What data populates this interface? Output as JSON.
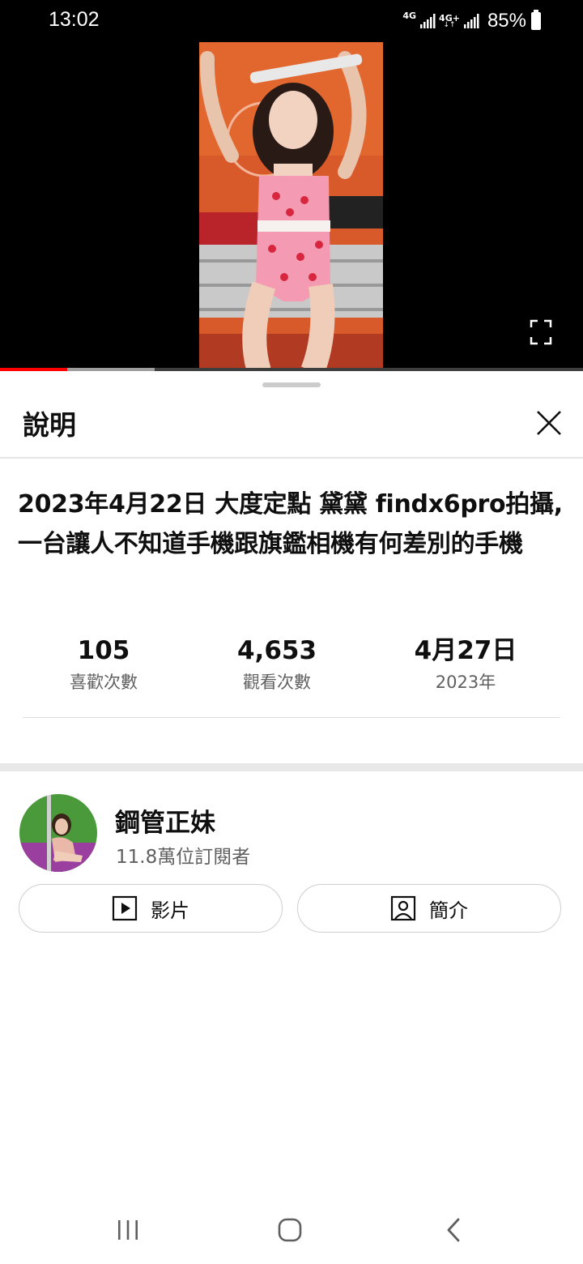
{
  "status_bar": {
    "time": "13:02",
    "network_1": "4G",
    "network_2": "4G+",
    "network_2_arrows": "↓↑",
    "battery": "85%"
  },
  "player": {
    "progress_fraction": 0.115,
    "buffer_fraction": 0.265,
    "accent_color": "#ff0000"
  },
  "description_panel": {
    "title": "說明",
    "close_icon": "close-icon"
  },
  "video": {
    "title": "2023年4月22日 大度定點 黛黛 findx6pro拍攝,一台讓人不知道手機跟旗鑑相機有何差別的手機"
  },
  "stats": [
    {
      "value": "105",
      "label": "喜歡次數"
    },
    {
      "value": "4,653",
      "label": "觀看次數"
    },
    {
      "value": "4月27日",
      "label": "2023年"
    }
  ],
  "channel": {
    "name": "鋼管正妹",
    "subscribers": "11.8萬位訂閱者",
    "videos_button": "影片",
    "about_button": "簡介"
  },
  "nav_bar": {
    "recents_icon": "recents-icon",
    "home_icon": "home-icon",
    "back_icon": "back-icon"
  }
}
